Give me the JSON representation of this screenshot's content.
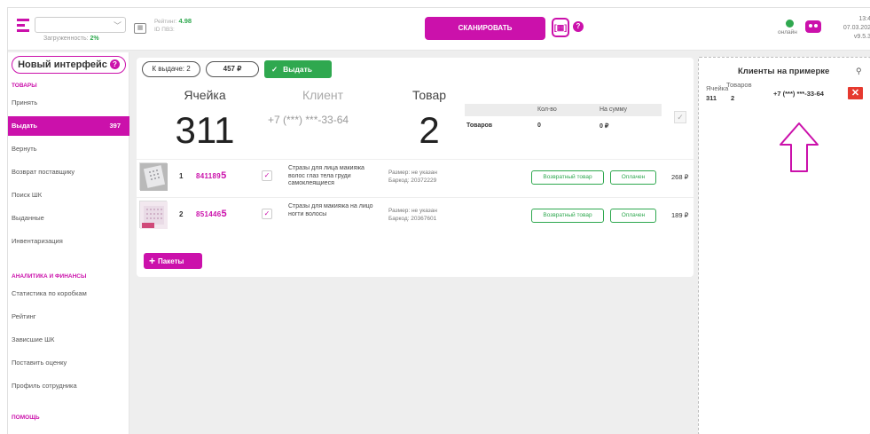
{
  "topbar": {
    "pvz_select_value": "",
    "load_label": "Загруженность:",
    "load_value": "2%",
    "rating_label": "Рейтинг:",
    "rating_value": "4.98",
    "pvz_id_label": "ID ПВЗ:",
    "scan_label": "СКАНИРОВАТЬ",
    "qr_glyph": "[▦]",
    "help_glyph": "?",
    "online_label": "онлайн",
    "time": "13:4",
    "date": "07.03.202",
    "version": "v9.5.3"
  },
  "sidebar": {
    "new_interface_label": "Новый интерфейс",
    "help_glyph": "?",
    "section_goods": "ТОВАРЫ",
    "items_goods": [
      {
        "label": "Принять",
        "count": ""
      },
      {
        "label": "Выдать",
        "count": "397"
      },
      {
        "label": "Вернуть",
        "count": ""
      },
      {
        "label": "Возврат поставщику",
        "count": ""
      },
      {
        "label": "Поиск ШК",
        "count": ""
      },
      {
        "label": "Выданные",
        "count": ""
      },
      {
        "label": "Инвентаризация",
        "count": ""
      }
    ],
    "section_analytics": "АНАЛИТИКА И ФИНАНСЫ",
    "items_analytics": [
      {
        "label": "Статистика по коробкам"
      },
      {
        "label": "Рейтинг"
      },
      {
        "label": "Зависшие ШК"
      },
      {
        "label": "Поставить оценку"
      },
      {
        "label": "Профиль сотрудника"
      }
    ],
    "section_help": "ПОМОЩЬ"
  },
  "main": {
    "to_issue_label": "К выдаче: 2",
    "amount_label": "457 ₽",
    "issue_button_label": "Выдать",
    "issue_check": "✓",
    "col_cell": "Ячейка",
    "col_client": "Клиент",
    "col_goods": "Товар",
    "cell_number": "311",
    "client_phone": "+7 (***) ***-33-64",
    "goods_count": "2",
    "summary": {
      "qty_header": "Кол-во",
      "amount_header": "На сумму",
      "row_label": "Товаров",
      "qty_value": "0",
      "amount_value": "0 ₽",
      "check": "✓"
    },
    "rows": [
      {
        "index": "1",
        "code_prefix": "841189",
        "code_last": "5",
        "check": "✓",
        "name": "Стразы для лица макияжа волос глаз тела груди самоклеящиеся",
        "size_label": "Размер:",
        "size_value": "не указан",
        "barcode_label": "Баркод:",
        "barcode_value": "20372229",
        "return_tag": "Возвратный товар",
        "paid_tag": "Оплачен",
        "price": "268 ₽"
      },
      {
        "index": "2",
        "code_prefix": "851446",
        "code_last": "5",
        "check": "✓",
        "name": "Стразы для макияжа на лицо ногти волосы",
        "size_label": "Размер:",
        "size_value": "не указан",
        "barcode_label": "Баркод:",
        "barcode_value": "20367601",
        "return_tag": "Возвратный товар",
        "paid_tag": "Оплачен",
        "price": "189 ₽"
      }
    ],
    "packets_plus": "+",
    "packets_label": "Пакеты"
  },
  "right_panel": {
    "title": "Клиенты на примерке",
    "pin_glyph": "⚲",
    "cell_header": "Ячейка",
    "goods_header": "Товаров",
    "cell_value": "311",
    "goods_value": "2",
    "phone": "+7 (***) ***-33-64",
    "close_glyph": "✕"
  },
  "colors": {
    "brand": "#cb11ab",
    "success": "#2fa84f",
    "danger": "#e6392f"
  },
  "icons": {
    "menu": "menu-icon",
    "chevron": "chevron-down-icon",
    "qr": "qr-code-icon",
    "help": "help-icon",
    "online": "online-status-icon",
    "bot": "bot-icon",
    "check": "check-icon",
    "plus": "plus-icon",
    "pin": "pin-icon",
    "close": "close-icon",
    "arrow": "arrow-up-icon"
  }
}
